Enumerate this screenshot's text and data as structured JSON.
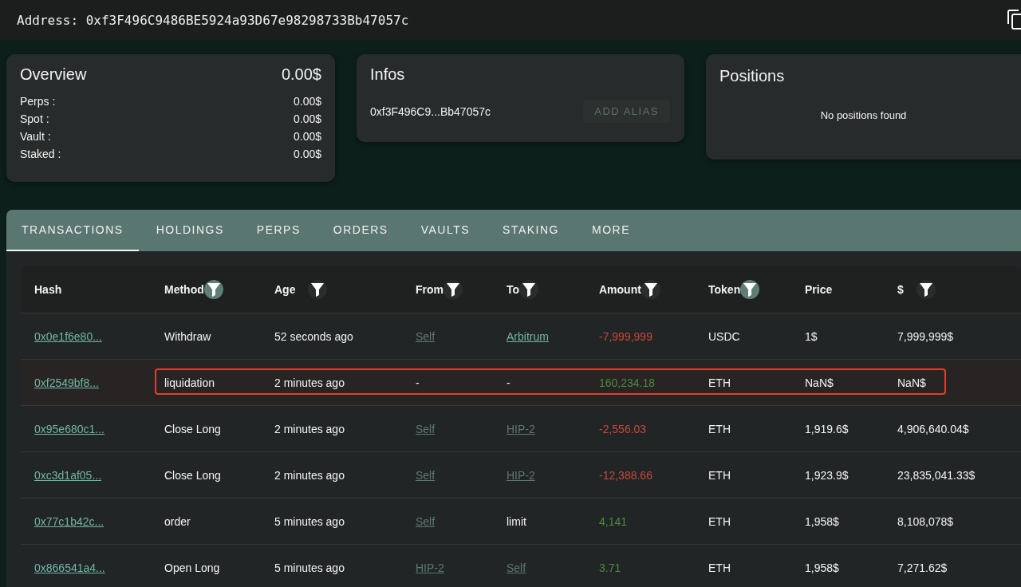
{
  "address_bar": {
    "label": "Address:",
    "value": "0xf3F496C9486BE5924a93D67e98298733Bb47057c"
  },
  "overview": {
    "title": "Overview",
    "total": "0.00$",
    "rows": [
      {
        "label": "Perps :",
        "value": "0.00$"
      },
      {
        "label": "Spot :",
        "value": "0.00$"
      },
      {
        "label": "Vault :",
        "value": "0.00$"
      },
      {
        "label": "Staked :",
        "value": "0.00$"
      }
    ]
  },
  "infos": {
    "title": "Infos",
    "address": "0xf3F496C9...Bb47057c",
    "button": {
      "label": "ADD ALIAS",
      "disabled": true
    }
  },
  "positions": {
    "title": "Positions",
    "empty_text": "No positions found"
  },
  "tabs": [
    {
      "label": "TRANSACTIONS",
      "selected": true
    },
    {
      "label": "HOLDINGS",
      "selected": false
    },
    {
      "label": "PERPS",
      "selected": false
    },
    {
      "label": "ORDERS",
      "selected": false
    },
    {
      "label": "VAULTS",
      "selected": false
    },
    {
      "label": "STAKING",
      "selected": false
    },
    {
      "label": "MORE",
      "selected": false
    }
  ],
  "table": {
    "columns": [
      {
        "label": "Hash"
      },
      {
        "label": "Method",
        "filter": {
          "active": true
        }
      },
      {
        "label": "Age",
        "filter": {
          "active": false
        }
      },
      {
        "label": "From",
        "filter": {
          "active": false
        }
      },
      {
        "label": "To",
        "filter": {
          "active": false
        }
      },
      {
        "label": "Amount",
        "filter": {
          "active": false
        }
      },
      {
        "label": "Token",
        "filter": {
          "active": true
        }
      },
      {
        "label": "Price"
      },
      {
        "label": "$",
        "filter": {
          "active": false
        }
      }
    ],
    "rows": [
      {
        "highlighted": false,
        "hash": "0x0e1f6e80...",
        "method": "Withdraw",
        "age": "52 seconds ago",
        "from": {
          "text": "Self",
          "kind": "dim-link"
        },
        "to": {
          "text": "Arbitrum",
          "kind": "link"
        },
        "amount": {
          "text": "-7,999,999",
          "color": "#c9463a"
        },
        "token": "USDC",
        "price": "1$",
        "usd": "7,999,999$"
      },
      {
        "highlighted": true,
        "hash": "0xf2549bf8...",
        "method": "liquidation",
        "age": "2 minutes ago",
        "from": {
          "text": "-",
          "kind": "text"
        },
        "to": {
          "text": "-",
          "kind": "text"
        },
        "amount": {
          "text": "160,234.18",
          "color": "#4e8b3e"
        },
        "token": "ETH",
        "price": "NaN$",
        "usd": "NaN$"
      },
      {
        "highlighted": false,
        "hash": "0x95e680c1...",
        "method": "Close Long",
        "age": "2 minutes ago",
        "from": {
          "text": "Self",
          "kind": "dim-link"
        },
        "to": {
          "text": "HIP-2",
          "kind": "dim-link"
        },
        "amount": {
          "text": "-2,556.03",
          "color": "#c9463a"
        },
        "token": "ETH",
        "price": "1,919.6$",
        "usd": "4,906,640.04$"
      },
      {
        "highlighted": false,
        "hash": "0xc3d1af05...",
        "method": "Close Long",
        "age": "2 minutes ago",
        "from": {
          "text": "Self",
          "kind": "dim-link"
        },
        "to": {
          "text": "HIP-2",
          "kind": "dim-link"
        },
        "amount": {
          "text": "-12,388.66",
          "color": "#c9463a"
        },
        "token": "ETH",
        "price": "1,923.9$",
        "usd": "23,835,041.33$"
      },
      {
        "highlighted": false,
        "hash": "0x77c1b42c...",
        "method": "order",
        "age": "5 minutes ago",
        "from": {
          "text": "Self",
          "kind": "dim-link"
        },
        "to": {
          "text": "limit",
          "kind": "text"
        },
        "amount": {
          "text": "4,141",
          "color": "#4e8b3e"
        },
        "token": "ETH",
        "price": "1,958$",
        "usd": "8,108,078$"
      },
      {
        "highlighted": false,
        "hash": "0x866541a4...",
        "method": "Open Long",
        "age": "5 minutes ago",
        "from": {
          "text": "HIP-2",
          "kind": "dim-link"
        },
        "to": {
          "text": "Self",
          "kind": "dim-link"
        },
        "amount": {
          "text": "3.71",
          "color": "#4e8b3e"
        },
        "token": "ETH",
        "price": "1,958$",
        "usd": "7,271.62$"
      }
    ]
  }
}
